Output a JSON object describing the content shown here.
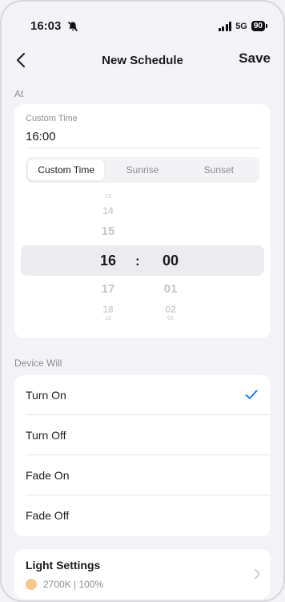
{
  "status_bar": {
    "time": "16:03",
    "network": "5G",
    "battery": "90"
  },
  "nav": {
    "title": "New Schedule",
    "save_label": "Save"
  },
  "at_section": {
    "label": "At",
    "custom_time_label": "Custom Time",
    "custom_time_value": "16:00",
    "segments": [
      "Custom Time",
      "Sunrise",
      "Sunset"
    ],
    "selected_segment": "Custom Time",
    "picker": {
      "hours": [
        "13",
        "14",
        "15",
        "16",
        "17",
        "18",
        "19"
      ],
      "minutes": [
        "",
        "",
        "",
        "00",
        "01",
        "02",
        "03"
      ],
      "selected_hour": "16",
      "selected_minute": "00",
      "separator": ":"
    }
  },
  "device_will": {
    "label": "Device Will",
    "options": [
      "Turn On",
      "Turn Off",
      "Fade On",
      "Fade Off"
    ],
    "selected": "Turn On"
  },
  "light_settings": {
    "title": "Light Settings",
    "summary": "2700K | 100%",
    "swatch_color": "#f5c88e"
  },
  "colors": {
    "accent": "#1a7cf0",
    "background": "#f2f2f7"
  }
}
